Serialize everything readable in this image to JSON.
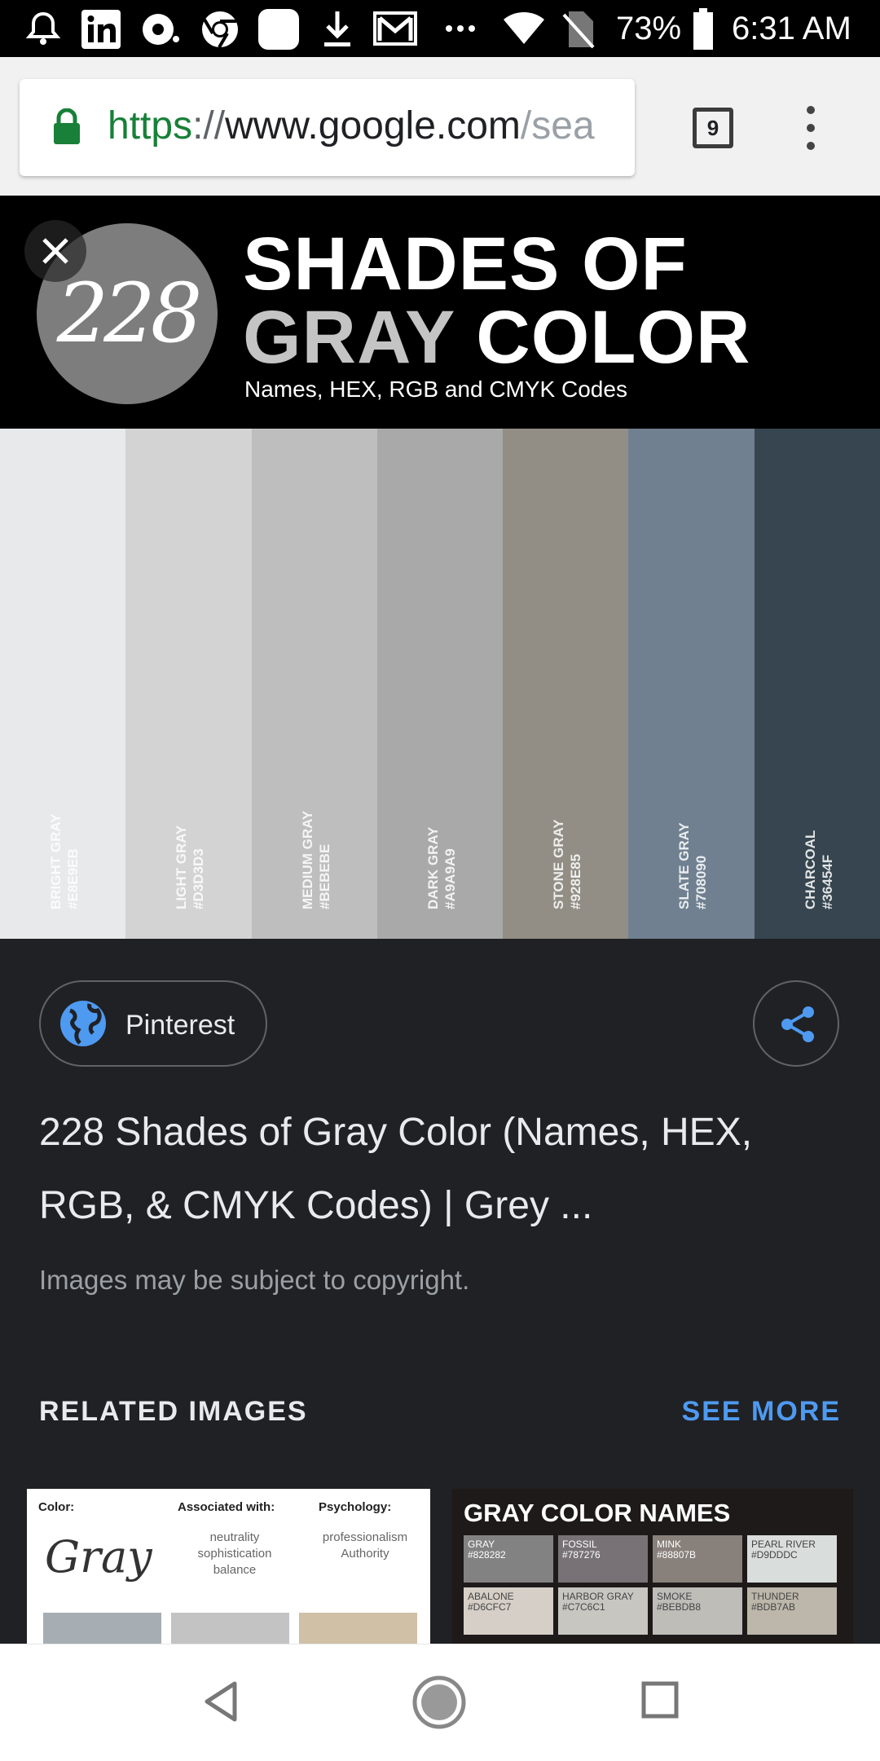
{
  "status_bar": {
    "battery_percent": "73%",
    "time": "6:31 AM",
    "icons": [
      "notification-bell-icon",
      "linkedin-icon",
      "cast-icon",
      "chrome-icon",
      "app-icon",
      "download-icon",
      "gmail-icon",
      "more-dots-icon",
      "wifi-icon",
      "no-sim-icon",
      "battery-icon"
    ]
  },
  "browser": {
    "url_scheme": "https",
    "url_sep": "://",
    "url_host": "www.google.com",
    "url_path": "/sea",
    "tab_count": "9"
  },
  "hero": {
    "badge_number": "228",
    "title_line1": "SHADES OF",
    "title_line2_gray": "GRAY",
    "title_line2_white": "COLOR",
    "subtitle": "Names, HEX, RGB and CMYK Codes",
    "swatches": [
      {
        "name": "BRIGHT GRAY",
        "hex": "#E8E9EB",
        "color": "#E8E9EB"
      },
      {
        "name": "LIGHT GRAY",
        "hex": "#D3D3D3",
        "color": "#D3D3D3"
      },
      {
        "name": "MEDIUM GRAY",
        "hex": "#BEBEBE",
        "color": "#BEBEBE"
      },
      {
        "name": "DARK GRAY",
        "hex": "#A9A9A9",
        "color": "#A9A9A9"
      },
      {
        "name": "STONE GRAY",
        "hex": "#928E85",
        "color": "#928E85"
      },
      {
        "name": "SLATE GRAY",
        "hex": "#708090",
        "color": "#708090"
      },
      {
        "name": "CHARCOAL",
        "hex": "#36454F",
        "color": "#36454F"
      }
    ]
  },
  "result": {
    "source": "Pinterest",
    "title": "228 Shades of Gray Color (Names, HEX, RGB, & CMYK Codes) | Grey ...",
    "copyright": "Images may be subject to copyright."
  },
  "related": {
    "header": "RELATED IMAGES",
    "see_more": "SEE MORE",
    "thumb1": {
      "col_color": "Color:",
      "col_assoc": "Associated with:",
      "col_psych": "Psychology:",
      "gray_word": "Gray",
      "assoc_text": "neutrality sophistication balance",
      "psych_text": "professionalism Authority"
    },
    "thumb2": {
      "title": "GRAY COLOR NAMES",
      "cells": [
        {
          "name": "GRAY",
          "hex": "#828282",
          "color": "#828282"
        },
        {
          "name": "FOSSIL",
          "hex": "#787276",
          "color": "#787276"
        },
        {
          "name": "MINK",
          "hex": "#88807B",
          "color": "#88807B"
        },
        {
          "name": "PEARL RIVER",
          "hex": "#D9DDDC",
          "color": "#D9DDDC"
        },
        {
          "name": "ABALONE",
          "hex": "#D6CFC7",
          "color": "#D6CFC7"
        },
        {
          "name": "HARBOR GRAY",
          "hex": "#C7C6C1",
          "color": "#C7C6C1"
        },
        {
          "name": "SMOKE",
          "hex": "#BEBDB8",
          "color": "#BEBDB8"
        },
        {
          "name": "THUNDER",
          "hex": "#BDB7AB",
          "color": "#BDB7AB"
        }
      ]
    }
  },
  "colors": {
    "accent": "#4E9AF1",
    "background": "#202124",
    "secure_green": "#188038"
  }
}
